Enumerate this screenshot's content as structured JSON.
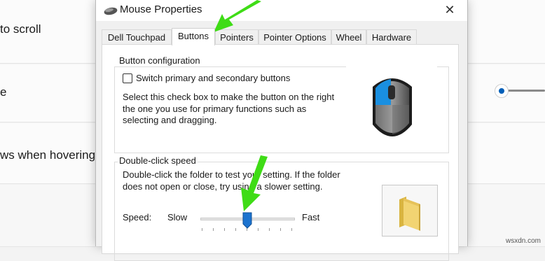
{
  "background": {
    "row1_text": "to scroll",
    "row2_text": "e",
    "row3_text": "ws when hovering o"
  },
  "dialog": {
    "title": "Mouse Properties",
    "close_glyph": "✕",
    "tabs": [
      {
        "label": "Dell Touchpad"
      },
      {
        "label": "Buttons"
      },
      {
        "label": "Pointers"
      },
      {
        "label": "Pointer Options"
      },
      {
        "label": "Wheel"
      },
      {
        "label": "Hardware"
      }
    ],
    "active_tab": "Buttons",
    "button_config": {
      "title": "Button configuration",
      "checkbox_label": "Switch primary and secondary buttons",
      "checkbox_checked": false,
      "description_lines": [
        "Select this check box to make the button on the right",
        "the one you use for primary functions such as",
        "selecting and dragging."
      ]
    },
    "double_click": {
      "title": "Double-click speed",
      "description_lines": [
        "Double-click the folder to test your setting. If the folder",
        "does not open or close, try using a slower setting."
      ],
      "speed_label": "Speed:",
      "slow_label": "Slow",
      "fast_label": "Fast",
      "speed_value": 0.5
    }
  },
  "colors": {
    "annotation_arrow": "#3fdc16",
    "accent": "#005fb8",
    "mouse_button_highlight": "#1a8fe0"
  },
  "watermark": "wsxdn.com"
}
